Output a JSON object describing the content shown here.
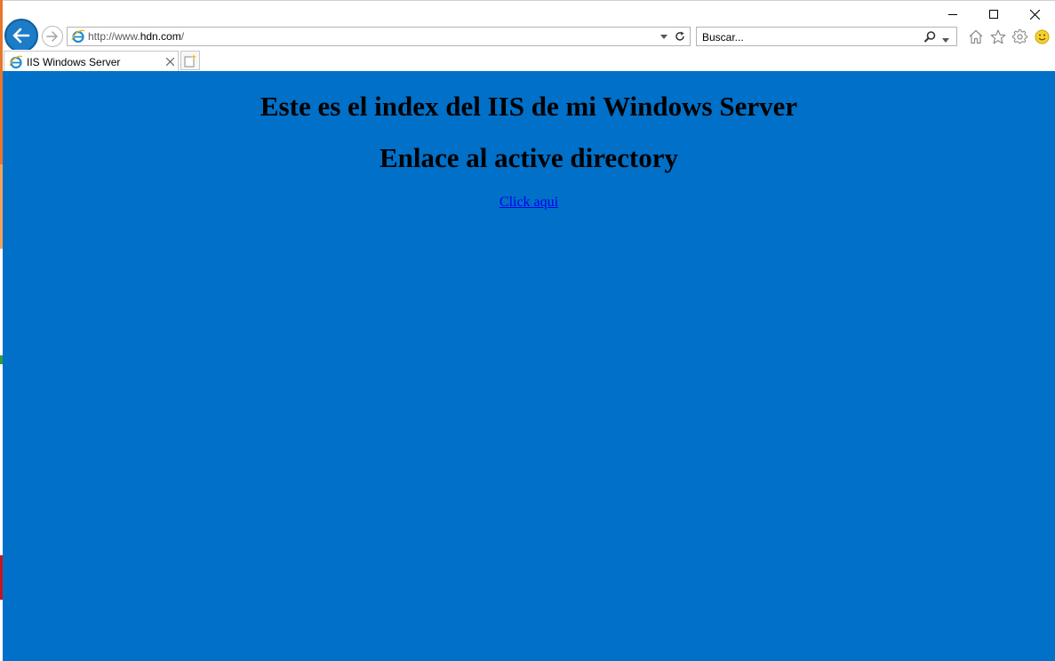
{
  "browser": {
    "address": {
      "prefix": "http://www.",
      "domain": "hdn.com",
      "suffix": "/"
    },
    "search": {
      "placeholder": "Buscar..."
    },
    "tab": {
      "title": "IIS Windows Server"
    }
  },
  "page": {
    "heading": "Este es el index del IIS de mi Windows Server",
    "subheading": "Enlace al active directory",
    "link_text": "Click aqui"
  },
  "colors": {
    "page_background": "#0070c8",
    "back_button": "#1c7cc8",
    "link": "#0000ee"
  },
  "icons": [
    "minimize-icon",
    "maximize-icon",
    "close-icon",
    "back-arrow-icon",
    "forward-arrow-icon",
    "ie-icon",
    "dropdown-icon",
    "refresh-icon",
    "search-icon",
    "home-icon",
    "favorites-star-icon",
    "gear-icon",
    "smiley-icon",
    "new-tab-icon"
  ]
}
